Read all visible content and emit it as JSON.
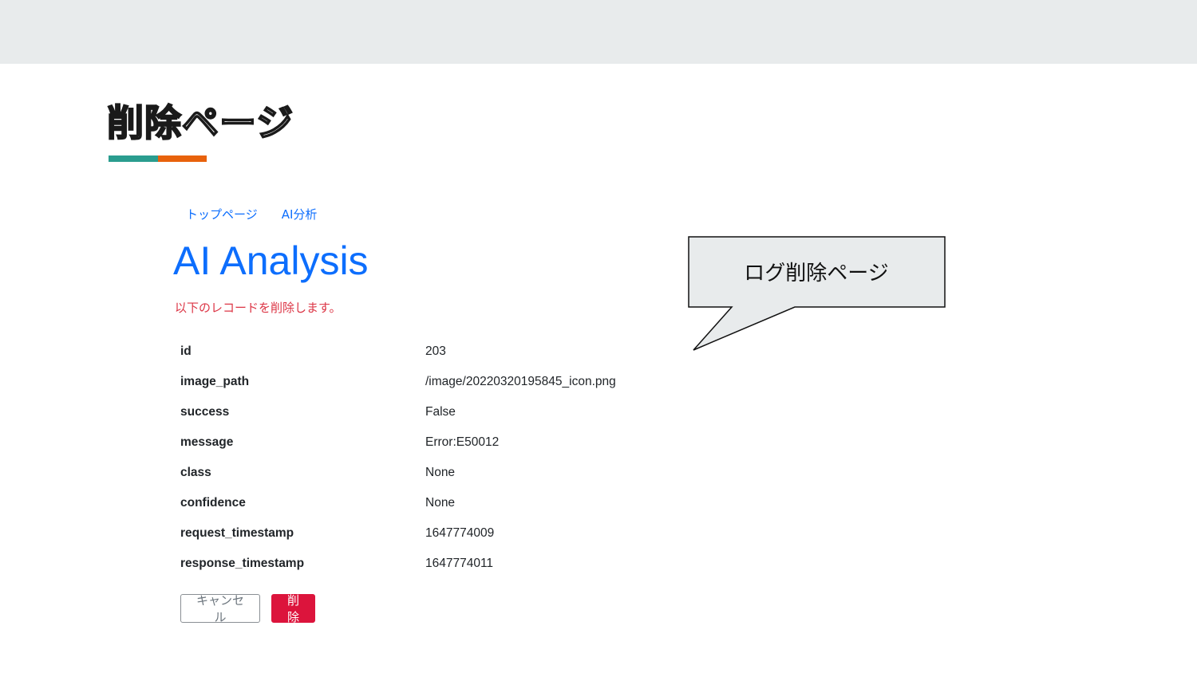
{
  "slide": {
    "title": "削除ページ",
    "underline_colors": [
      "#2a9d8f",
      "#e8620c"
    ],
    "band_color": "#e8ebec"
  },
  "nav": {
    "links": [
      {
        "label": "トップページ"
      },
      {
        "label": "AI分析"
      }
    ],
    "link_color": "#0d6efd"
  },
  "page": {
    "heading": "AI Analysis",
    "heading_color": "#0d6efd",
    "warning": "以下のレコードを削除します。",
    "warning_color": "#dc3545"
  },
  "record": {
    "rows": [
      {
        "key": "id",
        "value": "203"
      },
      {
        "key": "image_path",
        "value": "/image/20220320195845_icon.png"
      },
      {
        "key": "success",
        "value": "False"
      },
      {
        "key": "message",
        "value": "Error:E50012"
      },
      {
        "key": "class",
        "value": "None"
      },
      {
        "key": "confidence",
        "value": "None"
      },
      {
        "key": "request_timestamp",
        "value": "1647774009"
      },
      {
        "key": "response_timestamp",
        "value": "1647774011"
      }
    ]
  },
  "buttons": {
    "cancel_label": "キャンセル",
    "delete_label": "削除",
    "delete_color": "#dc143c"
  },
  "callout": {
    "text": "ログ削除ページ",
    "fill": "#e8ebec"
  }
}
